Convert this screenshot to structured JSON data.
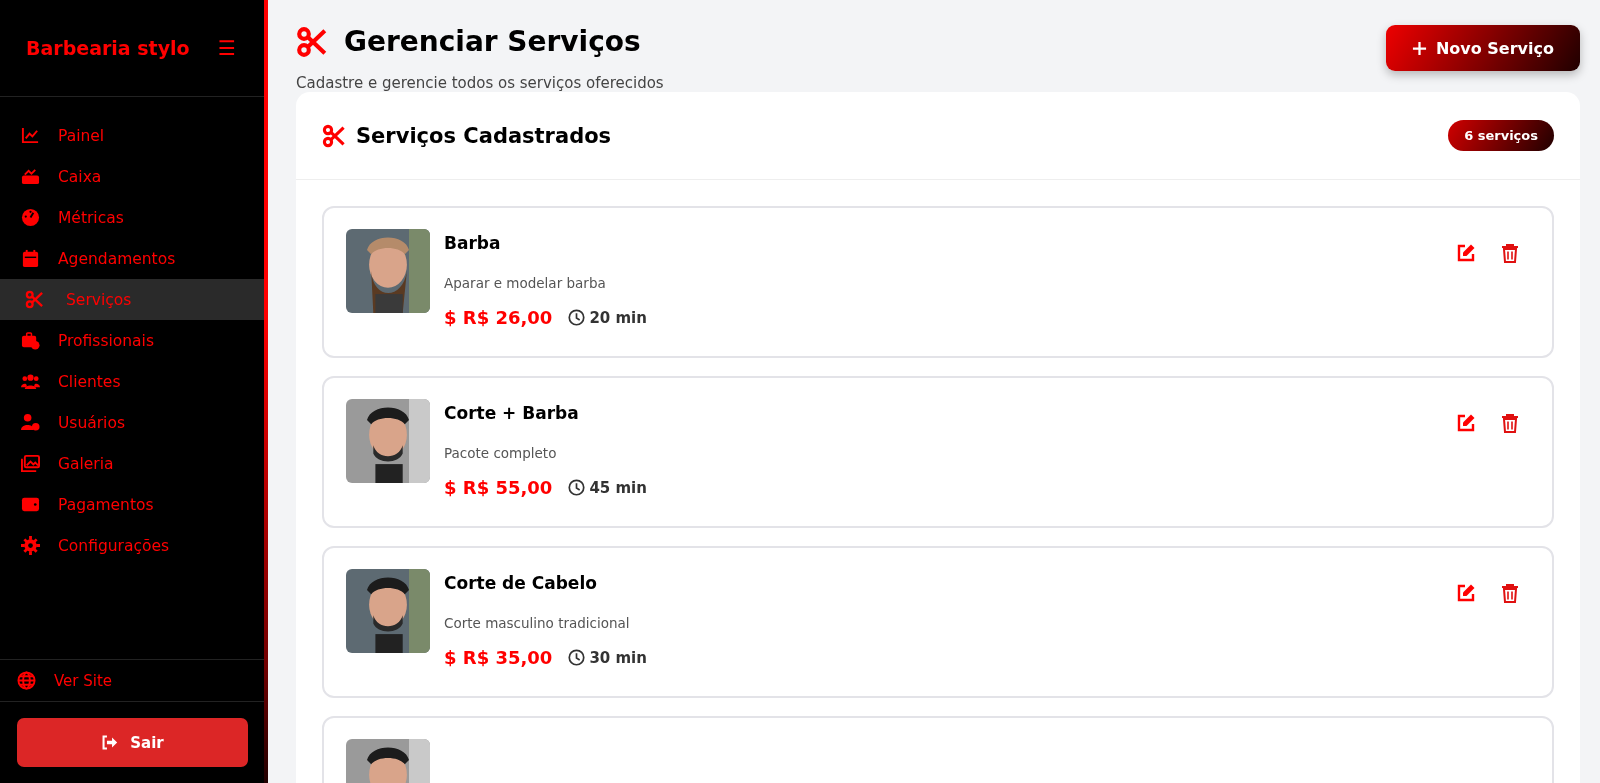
{
  "sidebar": {
    "brand": "Barbearia stylo",
    "menu_icon": "☰",
    "items": [
      {
        "label": "Painel",
        "selected": false
      },
      {
        "label": "Caixa",
        "selected": false
      },
      {
        "label": "Métricas",
        "selected": false
      },
      {
        "label": "Agendamentos",
        "selected": false
      },
      {
        "label": "Serviços",
        "selected": true
      },
      {
        "label": "Profissionais",
        "selected": false
      },
      {
        "label": "Clientes",
        "selected": false
      },
      {
        "label": "Usuários",
        "selected": false
      },
      {
        "label": "Galeria",
        "selected": false
      },
      {
        "label": "Pagamentos",
        "selected": false
      },
      {
        "label": "Configurações",
        "selected": false
      }
    ],
    "site_link": "Ver Site",
    "logout": "Sair"
  },
  "header": {
    "title": "Gerenciar Serviços",
    "subtitle": "Cadastre e gerencie todos os serviços oferecidos",
    "new_button": "Novo Serviço"
  },
  "panel": {
    "title": "Serviços Cadastrados",
    "count": "6 serviços",
    "services": [
      {
        "kind": "service",
        "name": "Barba",
        "description": "Aparar e modelar barba",
        "price": "$ R$ 26,00",
        "duration": "20 min"
      },
      {
        "kind": "service",
        "name": "Corte + Barba",
        "description": "Pacote completo",
        "price": "$ R$ 55,00",
        "duration": "45 min"
      },
      {
        "kind": "service",
        "name": "Corte de Cabelo",
        "description": "Corte masculino tradicional",
        "price": "$ R$ 35,00",
        "duration": "30 min"
      },
      {
        "kind": "picture"
      }
    ]
  }
}
